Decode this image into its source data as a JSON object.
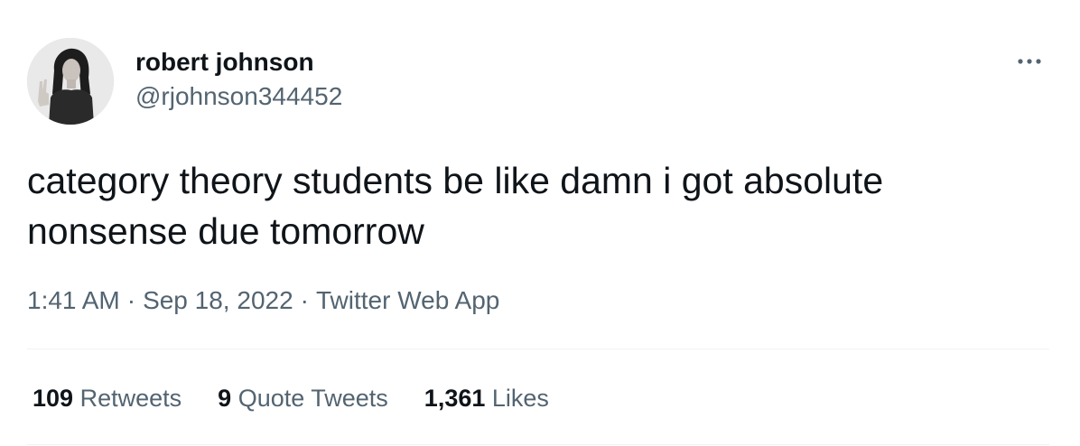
{
  "author": {
    "display_name": "robert johnson",
    "handle": "@rjohnson344452",
    "avatar_icon": "profile-photo"
  },
  "tweet": {
    "text": "category theory students be like damn i got absolute nonsense due tomorrow",
    "time": "1:41 AM",
    "date": "Sep 18, 2022",
    "source": "Twitter Web App",
    "separator": "·"
  },
  "stats": {
    "retweets": {
      "count": "109",
      "label": "Retweets"
    },
    "quote_tweets": {
      "count": "9",
      "label": "Quote Tweets"
    },
    "likes": {
      "count": "1,361",
      "label": "Likes"
    }
  },
  "colors": {
    "text_primary": "#0f1419",
    "text_secondary": "#536471",
    "divider": "#eff3f4"
  },
  "more_icon": "more-horizontal-icon"
}
